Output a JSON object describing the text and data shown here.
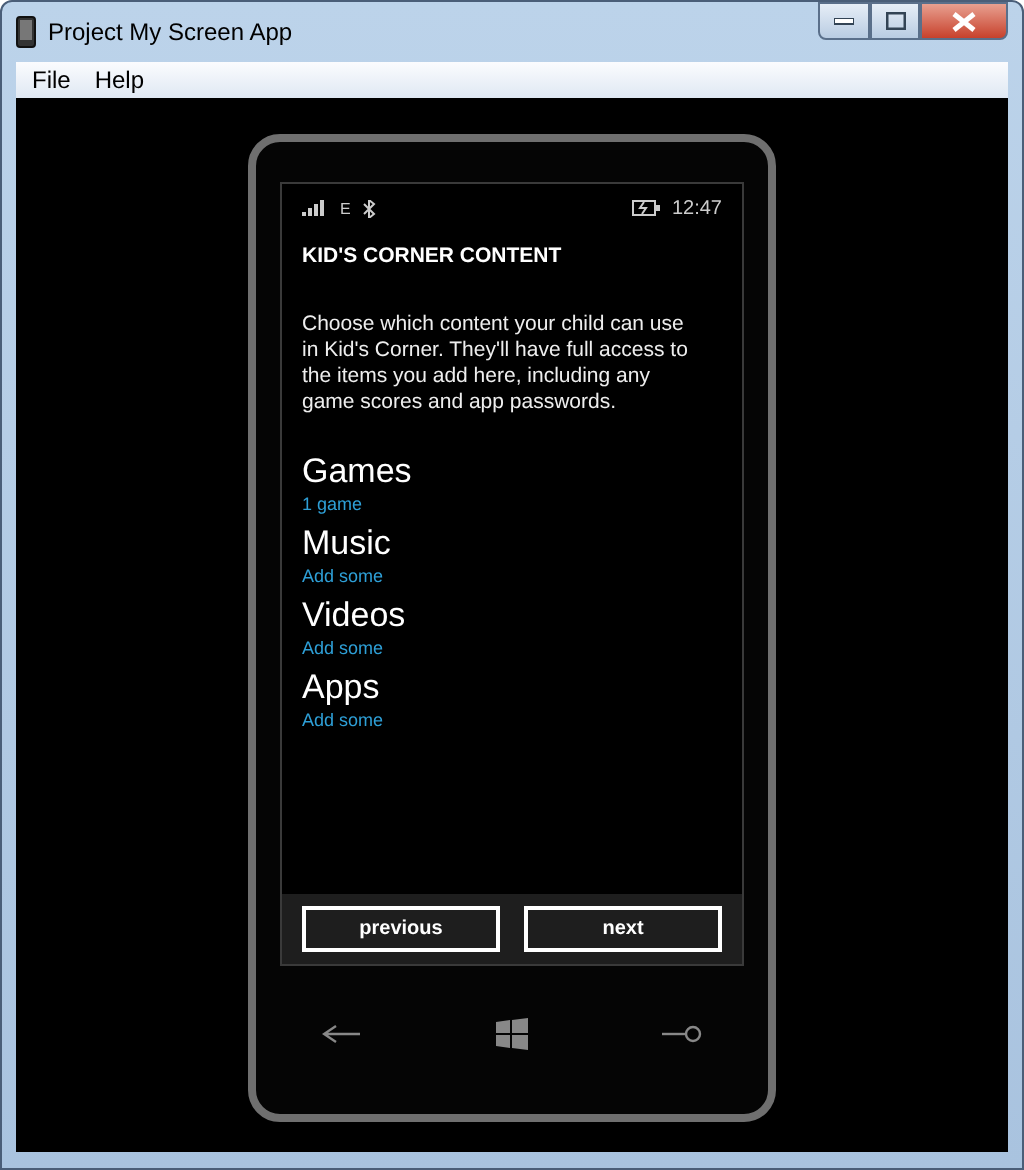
{
  "window": {
    "title": "Project My Screen App"
  },
  "menu": [
    "File",
    "Help"
  ],
  "phone": {
    "status_bar": {
      "network": "E",
      "time": "12:47"
    },
    "title": "KID'S CORNER CONTENT",
    "description": "Choose which content your child can use in Kid's Corner. They'll have full access to the items you add here, including any game scores and app passwords.",
    "categories": [
      {
        "name": "Games",
        "detail": "1 game"
      },
      {
        "name": "Music",
        "detail": "Add some"
      },
      {
        "name": "Videos",
        "detail": "Add some"
      },
      {
        "name": "Apps",
        "detail": "Add some"
      }
    ],
    "buttons": [
      "previous",
      "next"
    ]
  }
}
